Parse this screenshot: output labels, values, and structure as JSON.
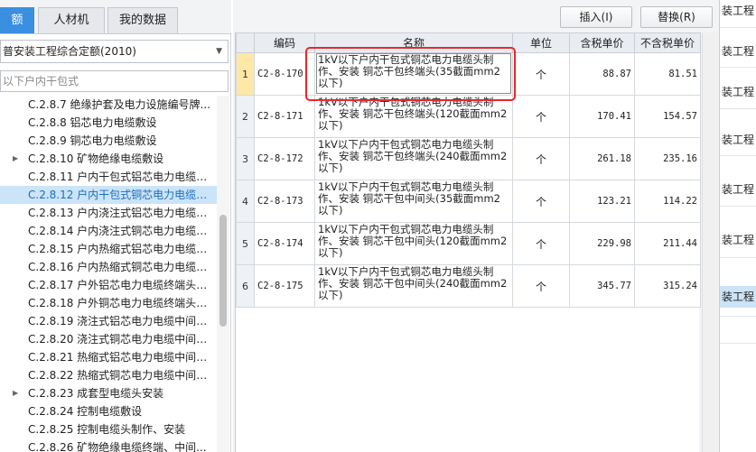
{
  "tabs": [
    {
      "label": "额",
      "active": true
    },
    {
      "label": "人材机",
      "active": false
    },
    {
      "label": "我的数据",
      "active": false
    }
  ],
  "quota_library": {
    "selected": "普安装工程综合定额(2010)"
  },
  "search": {
    "placeholder": "以下户内干包式"
  },
  "tree": [
    {
      "label": "C.2.8.7 绝缘护套及电力设施编号牌...",
      "expandable": false,
      "selected": false
    },
    {
      "label": "C.2.8.8 铝芯电力电缆敷设",
      "expandable": false,
      "selected": false
    },
    {
      "label": "C.2.8.9 铜芯电力电缆敷设",
      "expandable": false,
      "selected": false
    },
    {
      "label": "C.2.8.10 矿物绝缘电缆敷设",
      "expandable": true,
      "selected": false
    },
    {
      "label": "C.2.8.11 户内干包式铝芯电力电缆头...",
      "expandable": false,
      "selected": false
    },
    {
      "label": "C.2.8.12 户内干包式铜芯电力电缆头...",
      "expandable": false,
      "selected": true
    },
    {
      "label": "C.2.8.13 户内浇注式铝芯电力电缆终...",
      "expandable": false,
      "selected": false
    },
    {
      "label": "C.2.8.14 户内浇注式铜芯电力电缆终...",
      "expandable": false,
      "selected": false
    },
    {
      "label": "C.2.8.15 户内热缩式铝芯电力电缆终...",
      "expandable": false,
      "selected": false
    },
    {
      "label": "C.2.8.16 户内热缩式铜芯电力电缆终...",
      "expandable": false,
      "selected": false
    },
    {
      "label": "C.2.8.17 户外铝芯电力电缆终端头制...",
      "expandable": false,
      "selected": false
    },
    {
      "label": "C.2.8.18 户外铜芯电力电缆终端头制...",
      "expandable": false,
      "selected": false
    },
    {
      "label": "C.2.8.19 浇注式铝芯电力电缆中间头...",
      "expandable": false,
      "selected": false
    },
    {
      "label": "C.2.8.20 浇注式铜芯电力电缆中间头...",
      "expandable": false,
      "selected": false
    },
    {
      "label": "C.2.8.21 热缩式铝芯电力电缆中间头...",
      "expandable": false,
      "selected": false
    },
    {
      "label": "C.2.8.22 热缩式铜芯电力电缆中间头...",
      "expandable": false,
      "selected": false
    },
    {
      "label": "C.2.8.23 成套型电缆头安装",
      "expandable": true,
      "selected": false
    },
    {
      "label": "C.2.8.24 控制电缆敷设",
      "expandable": false,
      "selected": false
    },
    {
      "label": "C.2.8.25 控制电缆头制作、安装",
      "expandable": false,
      "selected": false
    },
    {
      "label": "C.2.8.26 矿物绝缘电缆终端、中间...",
      "expandable": false,
      "selected": false
    }
  ],
  "toolbar": {
    "insert_label": "插入(I)",
    "replace_label": "替换(R)"
  },
  "grid": {
    "headers": [
      "",
      "编码",
      "名称",
      "单位",
      "含税单价",
      "不含税单价"
    ],
    "rows": [
      {
        "no": "1",
        "code": "C2-8-170",
        "name": "1kV以下户内干包式铜芯电力电缆头制作、安装 铜芯干包终端头(35截面mm2以下)",
        "unit": "个",
        "price_tax": "88.87",
        "price_notax": "81.51",
        "active": true
      },
      {
        "no": "2",
        "code": "C2-8-171",
        "name": "1kV以下户内干包式铜芯电力电缆头制作、安装 铜芯干包终端头(120截面mm2以下)",
        "unit": "个",
        "price_tax": "170.41",
        "price_notax": "154.57",
        "active": false
      },
      {
        "no": "3",
        "code": "C2-8-172",
        "name": "1kV以下户内干包式铜芯电力电缆头制作、安装 铜芯干包终端头(240截面mm2以下)",
        "unit": "个",
        "price_tax": "261.18",
        "price_notax": "235.16",
        "active": false
      },
      {
        "no": "4",
        "code": "C2-8-173",
        "name": "1kV以下户内干包式铜芯电力电缆头制作、安装 铜芯干包中间头(35截面mm2以下)",
        "unit": "个",
        "price_tax": "123.21",
        "price_notax": "114.22",
        "active": false
      },
      {
        "no": "5",
        "code": "C2-8-174",
        "name": "1kV以下户内干包式铜芯电力电缆头制作、安装 铜芯干包中间头(120截面mm2以下)",
        "unit": "个",
        "price_tax": "229.98",
        "price_notax": "211.44",
        "active": false
      },
      {
        "no": "6",
        "code": "C2-8-175",
        "name": "1kV以下户内干包式铜芯电力电缆头制作、安装 铜芯干包中间头(240截面mm2以下)",
        "unit": "个",
        "price_tax": "345.77",
        "price_notax": "315.24",
        "active": false
      }
    ]
  },
  "far_panel": [
    "装工程",
    "装工程",
    "装工程",
    "装工程",
    "装工程",
    "装工程",
    "装工程"
  ],
  "colors": {
    "accent": "#3a8fe0",
    "selection": "#cce4f7",
    "highlight_box": "#e8272a"
  }
}
